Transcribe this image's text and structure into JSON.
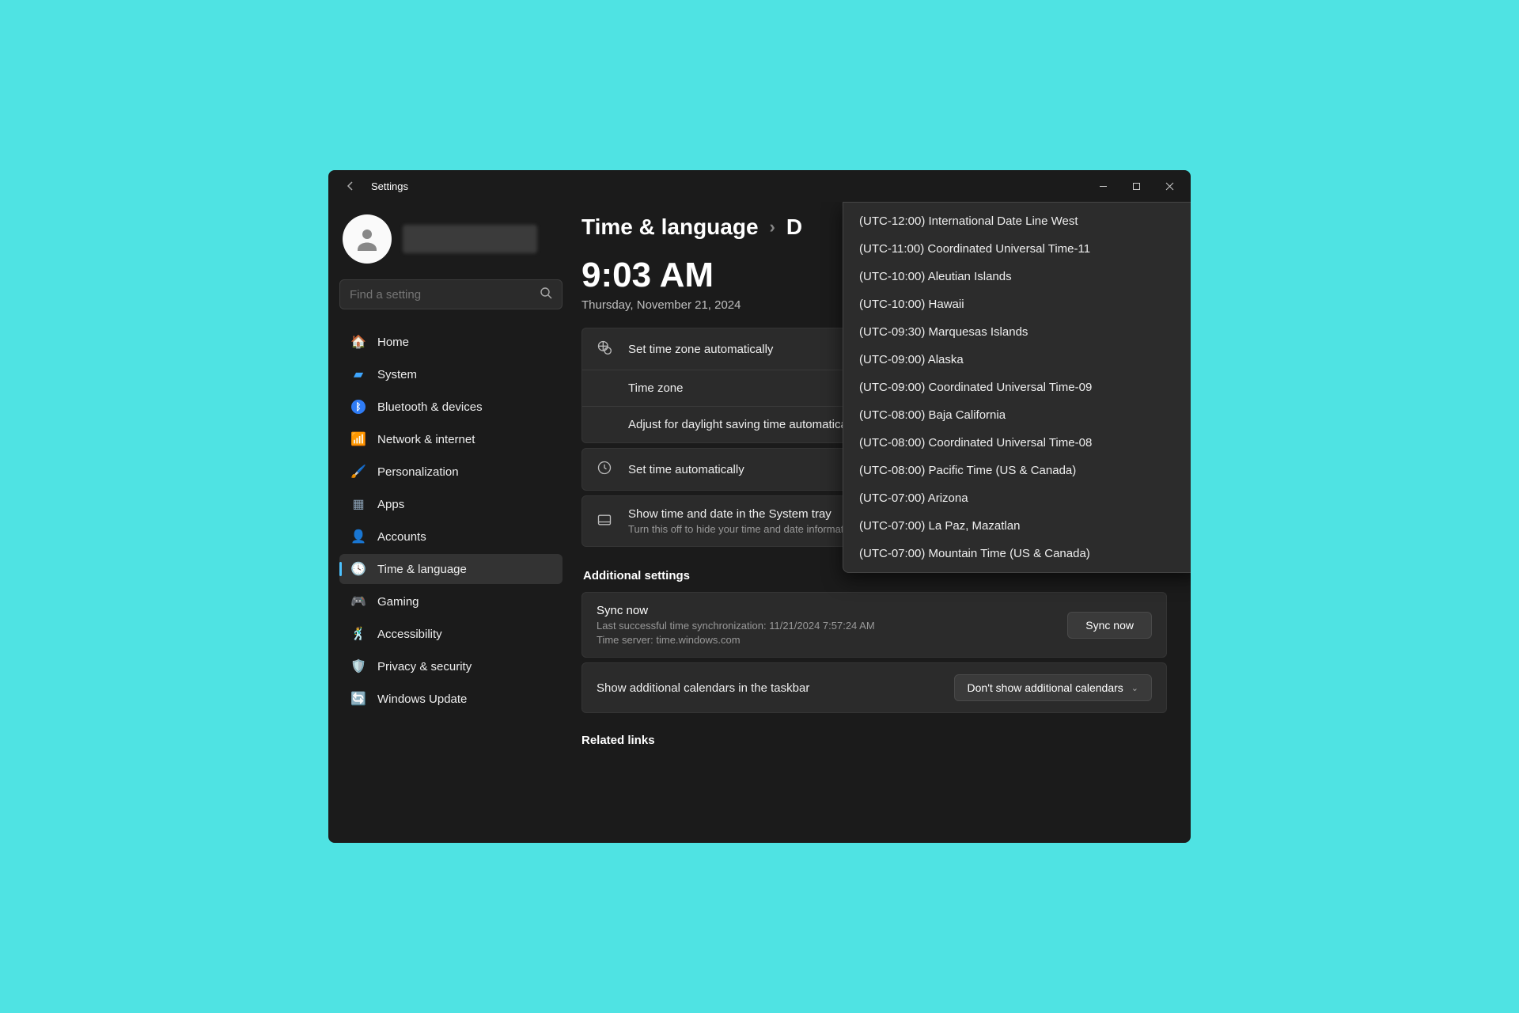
{
  "titlebar": {
    "title": "Settings"
  },
  "search": {
    "placeholder": "Find a setting"
  },
  "nav": {
    "items": [
      {
        "label": "Home"
      },
      {
        "label": "System"
      },
      {
        "label": "Bluetooth & devices"
      },
      {
        "label": "Network & internet"
      },
      {
        "label": "Personalization"
      },
      {
        "label": "Apps"
      },
      {
        "label": "Accounts"
      },
      {
        "label": "Time & language"
      },
      {
        "label": "Gaming"
      },
      {
        "label": "Accessibility"
      },
      {
        "label": "Privacy & security"
      },
      {
        "label": "Windows Update"
      }
    ]
  },
  "breadcrumb": {
    "parent": "Time & language",
    "current_prefix": "D"
  },
  "clock": {
    "time": "9:03 AM",
    "date": "Thursday, November 21, 2024"
  },
  "rows": {
    "set_tz_auto": "Set time zone automatically",
    "time_zone": "Time zone",
    "dst": "Adjust for daylight saving time automatically",
    "set_time_auto": "Set time automatically",
    "show_tray_title": "Show time and date in the System tray",
    "show_tray_sub": "Turn this off to hide your time and date information"
  },
  "additional": {
    "title": "Additional settings",
    "sync_title": "Sync now",
    "sync_last": "Last successful time synchronization: 11/21/2024 7:57:24 AM",
    "sync_server": "Time server: time.windows.com",
    "sync_button": "Sync now",
    "cal_label": "Show additional calendars in the taskbar",
    "cal_value": "Don't show additional calendars"
  },
  "related": {
    "title": "Related links"
  },
  "timezones": [
    "(UTC-12:00) International Date Line West",
    "(UTC-11:00) Coordinated Universal Time-11",
    "(UTC-10:00) Aleutian Islands",
    "(UTC-10:00) Hawaii",
    "(UTC-09:30) Marquesas Islands",
    "(UTC-09:00) Alaska",
    "(UTC-09:00) Coordinated Universal Time-09",
    "(UTC-08:00) Baja California",
    "(UTC-08:00) Coordinated Universal Time-08",
    "(UTC-08:00) Pacific Time (US & Canada)",
    "(UTC-07:00) Arizona",
    "(UTC-07:00) La Paz, Mazatlan",
    "(UTC-07:00) Mountain Time (US & Canada)"
  ]
}
